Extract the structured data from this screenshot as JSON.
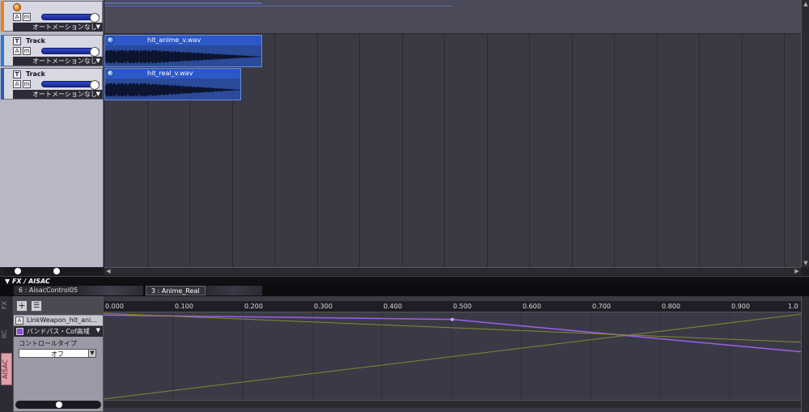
{
  "tracks": [
    {
      "type": "master",
      "name": "",
      "automation": "オートメーションなし",
      "accent": "#e8821a",
      "volume_fraction": 1.0
    },
    {
      "type": "track",
      "name": "Track",
      "automation": "オートメーションなし",
      "accent": "#2a7ad8",
      "volume_fraction": 1.0
    },
    {
      "type": "track",
      "name": "Track",
      "automation": "オートメーションなし",
      "accent": "#2a5ab8",
      "volume_fraction": 1.0
    }
  ],
  "clips": [
    {
      "name": "hit_anime_v.wav",
      "track": 1
    },
    {
      "name": "hit_real_v.wav",
      "track": 2
    }
  ],
  "fx_panel": {
    "title": "FX / AISAC",
    "tabs": [
      "6 : AisacControl05",
      "3 : Anime_Real"
    ],
    "side_tabs": [
      "FX",
      "RC",
      "AISAC"
    ],
    "aisac_item": "LinkWeapon_hit_ani...",
    "parameter": "バンドパス・Cof高域",
    "control_type_label": "コントロールタイプ",
    "control_type_value": "オフ",
    "ruler": [
      "0.000",
      "0.100",
      "0.200",
      "0.300",
      "0.400",
      "0.500",
      "0.600",
      "0.700",
      "0.800",
      "0.900",
      "1.0"
    ]
  },
  "colors": {
    "curve_purple": "#9a60e8",
    "curve_olive_a": "#8a8a30",
    "curve_olive_b": "#7a8a30"
  },
  "curves": [
    {
      "name": "purple",
      "points": [
        [
          0.0,
          0.97
        ],
        [
          0.5,
          0.92
        ],
        [
          1.0,
          0.55
        ]
      ]
    },
    {
      "name": "olive-falling",
      "points": [
        [
          0.0,
          0.99
        ],
        [
          1.0,
          0.66
        ]
      ]
    },
    {
      "name": "olive-rising",
      "points": [
        [
          0.0,
          0.01
        ],
        [
          1.0,
          0.98
        ]
      ]
    }
  ]
}
